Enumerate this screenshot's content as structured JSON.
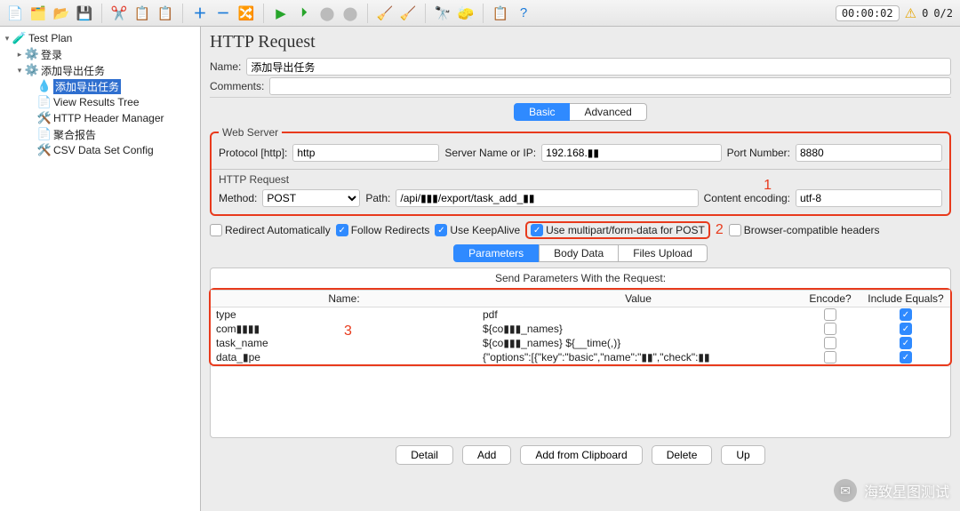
{
  "toolbar": {
    "timer": "00:00:02",
    "warn_count": "0",
    "counter": "0/2"
  },
  "tree": {
    "items": [
      {
        "label": "Test Plan",
        "indent": 0,
        "icon": "flask",
        "sel": false,
        "toggle": "▾"
      },
      {
        "label": "登录",
        "indent": 1,
        "icon": "gear",
        "sel": false,
        "toggle": "▸"
      },
      {
        "label": "添加导出任务",
        "indent": 1,
        "icon": "gear",
        "sel": false,
        "toggle": "▾"
      },
      {
        "label": "添加导出任务",
        "indent": 2,
        "icon": "dropper",
        "sel": true,
        "toggle": ""
      },
      {
        "label": "View Results Tree",
        "indent": 2,
        "icon": "page",
        "sel": false,
        "toggle": ""
      },
      {
        "label": "HTTP Header Manager",
        "indent": 2,
        "icon": "wrench",
        "sel": false,
        "toggle": ""
      },
      {
        "label": "聚合报告",
        "indent": 2,
        "icon": "page",
        "sel": false,
        "toggle": ""
      },
      {
        "label": "CSV Data Set Config",
        "indent": 2,
        "icon": "wrench",
        "sel": false,
        "toggle": ""
      }
    ]
  },
  "page": {
    "title": "HTTP Request",
    "name_label": "Name:",
    "name_value": "添加导出任务",
    "comments_label": "Comments:",
    "comments_value": ""
  },
  "tabs_top": {
    "basic": "Basic",
    "advanced": "Advanced"
  },
  "web_server": {
    "legend": "Web Server",
    "protocol_label": "Protocol [http]:",
    "protocol_value": "http",
    "server_label": "Server Name or IP:",
    "server_value": "192.168.▮▮",
    "port_label": "Port Number:",
    "port_value": "8880"
  },
  "http_request": {
    "legend": "HTTP Request",
    "method_label": "Method:",
    "method_value": "POST",
    "path_label": "Path:",
    "path_value": "/api/▮▮▮/export/task_add_▮▮",
    "enc_label": "Content encoding:",
    "enc_value": "utf-8"
  },
  "checks": {
    "redirect_auto": "Redirect Automatically",
    "follow_redirects": "Follow Redirects",
    "keepalive": "Use KeepAlive",
    "multipart": "Use multipart/form-data for POST",
    "browser_compat": "Browser-compatible headers"
  },
  "tabs_data": {
    "params": "Parameters",
    "body": "Body Data",
    "files": "Files Upload"
  },
  "param_table": {
    "caption": "Send Parameters With the Request:",
    "cols": {
      "name": "Name:",
      "value": "Value",
      "encode": "Encode?",
      "include": "Include Equals?"
    },
    "rows": [
      {
        "name": "type",
        "value": "pdf",
        "encode": false,
        "include": true
      },
      {
        "name": "com▮▮▮▮",
        "value": "${co▮▮▮_names}",
        "encode": false,
        "include": true
      },
      {
        "name": "task_name",
        "value": "${co▮▮▮_names} ${__time(,)}",
        "encode": false,
        "include": true
      },
      {
        "name": "data_▮pe",
        "value": "{\"options\":[{\"key\":\"basic\",\"name\":\"▮▮\",\"check\":▮▮",
        "encode": false,
        "include": true
      }
    ]
  },
  "buttons": {
    "detail": "Detail",
    "add": "Add",
    "add_clip": "Add from Clipboard",
    "delete": "Delete",
    "up": "Up"
  },
  "annotations": {
    "a1": "1",
    "a2": "2",
    "a3": "3"
  },
  "watermark": "海致星图测试"
}
